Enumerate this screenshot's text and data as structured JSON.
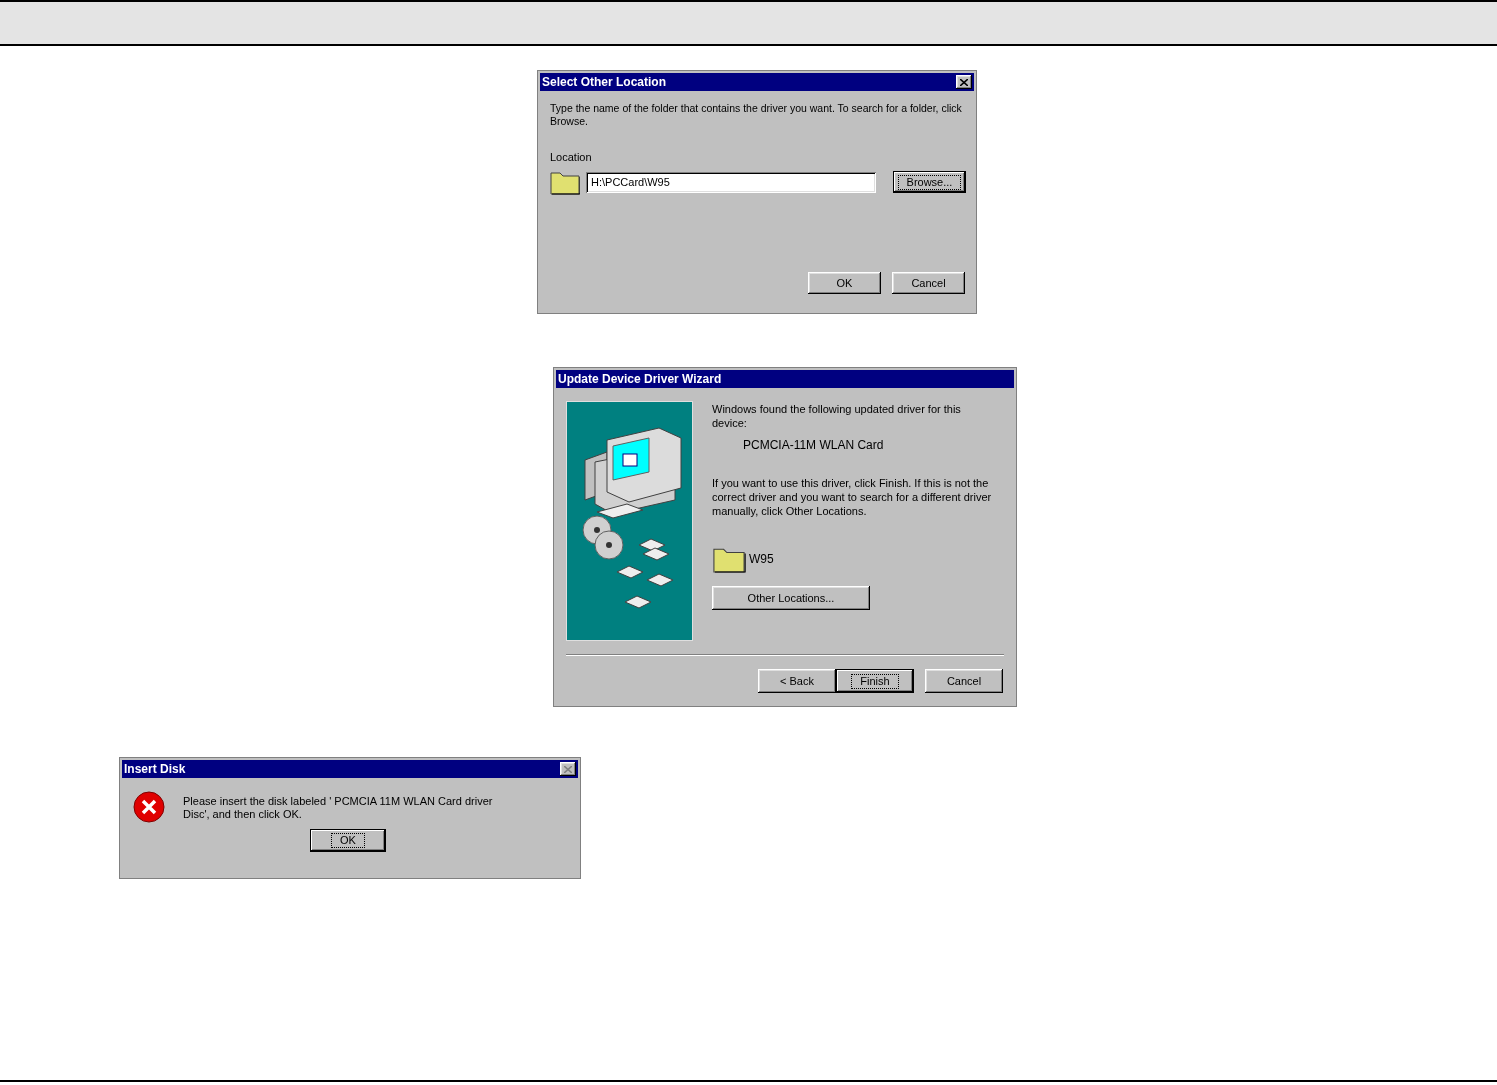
{
  "select_location_dialog": {
    "title": "Select Other Location",
    "close_disabled": false,
    "instructions": "Type the name of the folder that contains the driver you want. To search for a folder, click Browse.",
    "location_label": "Location",
    "location_value": "H:\\PCCard\\W95",
    "browse_button": {
      "label": "Browse...",
      "focused": true
    },
    "buttons": [
      {
        "label": "OK",
        "focused": false
      },
      {
        "label": "Cancel",
        "focused": false
      }
    ]
  },
  "wizard_dialog": {
    "title": "Update Device Driver Wizard",
    "found_text": "Windows found the following updated driver for this device:",
    "device_name": "PCMCIA-11M WLAN Card",
    "explanation": "If you want to use this driver, click Finish. If this is not the correct driver and you want to search for a different driver manually, click Other Locations.",
    "folder_name": "W95",
    "other_locations_button": {
      "label": "Other Locations...",
      "focused": false
    },
    "buttons": [
      {
        "label": "< Back",
        "focused": false
      },
      {
        "label": "Finish",
        "focused": true
      },
      {
        "label": "Cancel",
        "focused": false
      }
    ]
  },
  "insert_disk_dialog": {
    "title": "Insert Disk",
    "close_disabled": true,
    "message": "Please insert the disk labeled ' PCMCIA 11M WLAN Card driver Disc', and then click OK.",
    "ok_button": {
      "label": "OK",
      "focused": true
    }
  }
}
